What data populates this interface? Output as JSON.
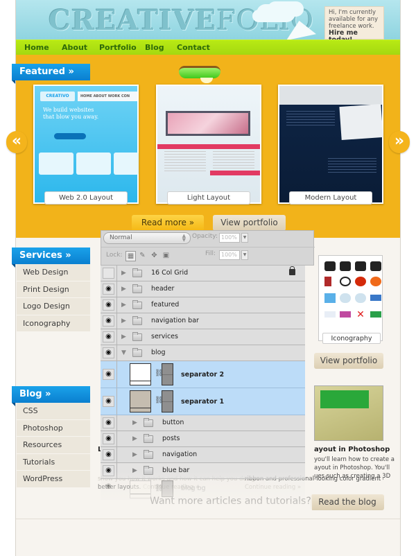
{
  "header": {
    "logo_bold": "CREATIVE",
    "logo_light": "FOLIO",
    "hire": {
      "line1": "Hi, I'm currently",
      "line2": "available for any",
      "line3": "freelance work.",
      "cta": "Hire me today!"
    }
  },
  "nav": {
    "items": [
      "Home",
      "About",
      "Portfolio",
      "Blog",
      "Contact"
    ]
  },
  "featured": {
    "title": "Featured »",
    "prev_icon": "«",
    "next_icon": "»",
    "items": [
      {
        "label": "Web 2.0 Layout",
        "brand": "CREATIVO",
        "nav": "HOME ABOUT WORK CON",
        "headline": "We build websites that blow you away."
      },
      {
        "label": "Light Layout"
      },
      {
        "label": "Modern Layout"
      }
    ],
    "read_more": "Read more »",
    "view_portfolio": "View portfolio"
  },
  "services": {
    "title": "Services »",
    "items": [
      "Web Design",
      "Print Design",
      "Logo Design",
      "Iconography"
    ],
    "thumb_label": "Iconography",
    "view_portfolio": "View portfolio"
  },
  "blog": {
    "title": "Blog »",
    "items": [
      "CSS",
      "Photoshop",
      "Resources",
      "Tutorials",
      "WordPress"
    ],
    "post_left": {
      "title": "L",
      "excerpt_1": "show you how it works and how it can help you design",
      "excerpt_2": "better layouts.",
      "more": "Continue reading »"
    },
    "post_right": {
      "title": "ayout in Photoshop",
      "l1": "you'll learn how to create a",
      "l2": "ayout in Photoshop. You'll",
      "l3": "ues such as creating a 3D",
      "l4": "ribbon and professional-looking color gradient effects.",
      "more": "Continue reading »"
    },
    "more_text": "Want more articles and tutorials?",
    "read_blog": "Read the blog"
  },
  "layers_panel": {
    "blend_mode": "Normal",
    "opacity_label": "Opacity:",
    "opacity_value": "100%",
    "lock_label": "Lock:",
    "fill_label": "Fill:",
    "fill_value": "100%",
    "layers": [
      {
        "name": "16 Col Grid",
        "type": "group",
        "visible": false,
        "locked": true,
        "depth": 0
      },
      {
        "name": "header",
        "type": "group",
        "visible": true,
        "depth": 0
      },
      {
        "name": "featured",
        "type": "group",
        "visible": true,
        "depth": 0
      },
      {
        "name": "navigation bar",
        "type": "group",
        "visible": true,
        "depth": 0
      },
      {
        "name": "services",
        "type": "group",
        "visible": true,
        "depth": 0
      },
      {
        "name": "blog",
        "type": "group",
        "visible": true,
        "expanded": true,
        "depth": 0
      },
      {
        "name": "separator 2",
        "type": "layer",
        "visible": true,
        "selected": true,
        "depth": 1
      },
      {
        "name": "separator 1",
        "type": "layer",
        "visible": true,
        "selected": true,
        "depth": 1
      },
      {
        "name": "button",
        "type": "group",
        "visible": true,
        "depth": 1
      },
      {
        "name": "posts",
        "type": "group",
        "visible": true,
        "depth": 1
      },
      {
        "name": "navigation",
        "type": "group",
        "visible": true,
        "depth": 1
      },
      {
        "name": "blue bar",
        "type": "group",
        "visible": true,
        "depth": 1
      },
      {
        "name": "blog bg",
        "type": "layer",
        "visible": true,
        "depth": 1
      }
    ]
  },
  "colors": {
    "accent_blue": "#0a8fdc",
    "nav_green": "#a8dc10",
    "featured_orange": "#f2b31a",
    "selection_blue": "#bcdcf8"
  }
}
